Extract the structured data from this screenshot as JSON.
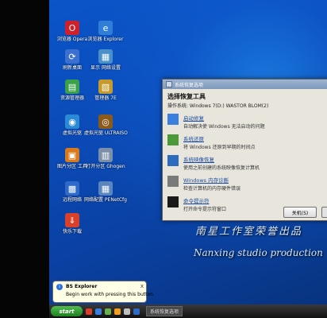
{
  "desktop": {
    "icons": [
      {
        "label": "浏览器 Opera",
        "glyph": "O",
        "color": "#d0202a"
      },
      {
        "label": "浏览器 Explorer",
        "glyph": "e",
        "color": "#2f7ed8"
      },
      {
        "label": "刷新桌面",
        "glyph": "⟳",
        "color": "#3b6fd0"
      },
      {
        "label": "显示 网络设置",
        "glyph": "▦",
        "color": "#4a90c8"
      },
      {
        "label": "资源管理器",
        "glyph": "▤",
        "color": "#3aa04a"
      },
      {
        "label": "管理器 7E",
        "glyph": "▧",
        "color": "#c69a2c"
      },
      {
        "label": "虚拟光驱",
        "glyph": "◉",
        "color": "#2b8ad6"
      },
      {
        "label": "虚拟光驱 ULTRAISO",
        "glyph": "◎",
        "color": "#8a5a1a"
      },
      {
        "label": "图片分区 工具",
        "glyph": "▣",
        "color": "#d87a1c"
      },
      {
        "label": "打开分区 Ghogen",
        "glyph": "▥",
        "color": "#7b8fa8"
      },
      {
        "label": "远程网络",
        "glyph": "▩",
        "color": "#2f6ac8"
      },
      {
        "label": "网络配置 PENetCfg",
        "glyph": "▦",
        "color": "#5a86c0"
      },
      {
        "label": "快乐下载",
        "glyph": "⇓",
        "color": "#d8402a"
      }
    ]
  },
  "window": {
    "title": "系统恢复选项",
    "heading": "选择恢复工具",
    "os_line": "操作系统: Windows 7(D:) WASTOR BLOM(2)",
    "options": [
      {
        "title": "启动修复",
        "desc": "自动解决使 Windows 无法启动的问题",
        "color": "#3a7ee0"
      },
      {
        "title": "系统还原",
        "desc": "将 Windows 还原到早期的时间点",
        "color": "#4a9a3a"
      },
      {
        "title": "系统映像恢复",
        "desc": "使用之前创建的系统映像恢复计算机",
        "color": "#2d6bbf"
      },
      {
        "title": "Windows 内存诊断",
        "desc": "检查计算机的内存硬件错误",
        "color": "#7a7a7a"
      },
      {
        "title": "命令提示符",
        "desc": "打开命令提示符窗口",
        "color": "#1a1a1a"
      }
    ],
    "close_label": "关机(S)"
  },
  "watermark": {
    "line1": "南星工作室荣誉出品",
    "line2": "Nanxing studio production"
  },
  "balloon": {
    "title": "BS Explorer",
    "text": "Begin work with pressing this button",
    "close": "x"
  },
  "taskbar": {
    "start_label": "start",
    "task_label": "系统恢复选项",
    "quick_icons": [
      "#d8402a",
      "#3a7ee0",
      "#6ab04c",
      "#f0a020",
      "#c0c0c0",
      "#2f6ac8"
    ]
  }
}
